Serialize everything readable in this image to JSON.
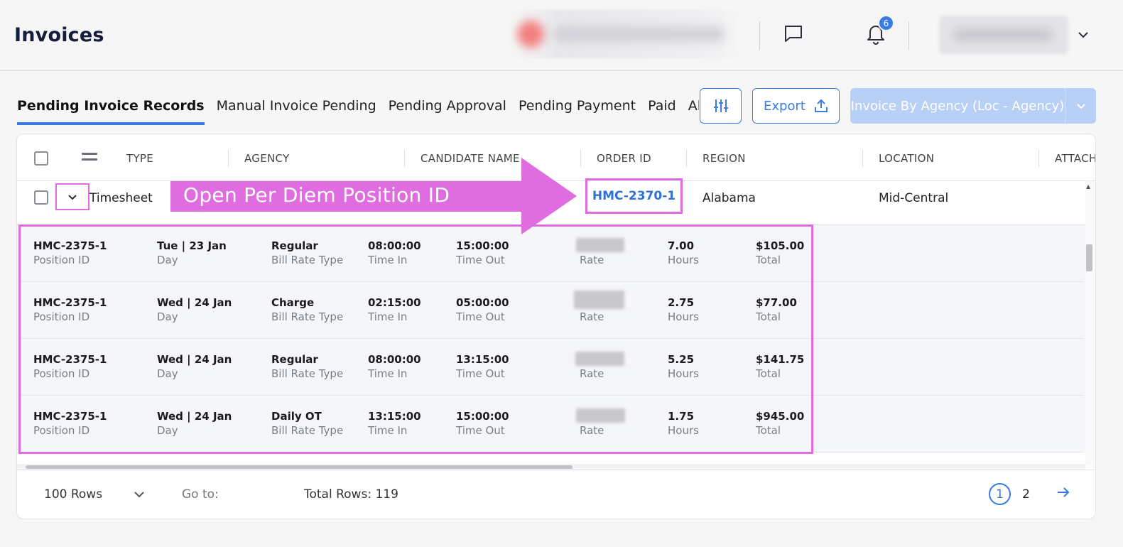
{
  "header": {
    "title": "Invoices",
    "notification_count": "6"
  },
  "tabs": [
    {
      "label": "Pending Invoice Records",
      "active": true
    },
    {
      "label": "Manual Invoice Pending",
      "active": false
    },
    {
      "label": "Pending Approval",
      "active": false
    },
    {
      "label": "Pending Payment",
      "active": false
    },
    {
      "label": "Paid",
      "active": false
    },
    {
      "label": "All Inv",
      "active": false
    }
  ],
  "toolbar": {
    "export_label": "Export",
    "invoice_button_label": "Invoice By Agency (Loc - Agency)"
  },
  "grid": {
    "columns": [
      "TYPE",
      "AGENCY",
      "CANDIDATE NAME",
      "ORDER ID",
      "REGION",
      "LOCATION",
      "ATTACHI"
    ],
    "row": {
      "type": "Timesheet",
      "order_id": "HMC-2370-1",
      "region": "Alabama",
      "location": "Mid-Central"
    },
    "detail_labels": {
      "position_id": "Position ID",
      "day": "Day",
      "bill_rate_type": "Bill Rate Type",
      "time_in": "Time In",
      "time_out": "Time Out",
      "rate": "Rate",
      "hours": "Hours",
      "total": "Total"
    },
    "detail_rows": [
      {
        "position_id": "HMC-2375-1",
        "day": "Tue | 23 Jan",
        "bill_rate_type": "Regular",
        "time_in": "08:00:00",
        "time_out": "15:00:00",
        "hours": "7.00",
        "total": "$105.00"
      },
      {
        "position_id": "HMC-2375-1",
        "day": "Wed | 24 Jan",
        "bill_rate_type": "Charge",
        "time_in": "02:15:00",
        "time_out": "05:00:00",
        "hours": "2.75",
        "total": "$77.00"
      },
      {
        "position_id": "HMC-2375-1",
        "day": "Wed | 24 Jan",
        "bill_rate_type": "Regular",
        "time_in": "08:00:00",
        "time_out": "13:15:00",
        "hours": "5.25",
        "total": "$141.75"
      },
      {
        "position_id": "HMC-2375-1",
        "day": "Wed | 24 Jan",
        "bill_rate_type": "Daily OT",
        "time_in": "13:15:00",
        "time_out": "15:00:00",
        "hours": "1.75",
        "total": "$945.00"
      }
    ]
  },
  "footer": {
    "rows_label": "100 Rows",
    "goto_label": "Go to:",
    "total_rows": "Total Rows: 119",
    "pages": [
      "1",
      "2"
    ]
  },
  "callout": {
    "text": "Open Per Diem Position ID",
    "color": "#df6ddf"
  },
  "colors": {
    "accent": "#3a7ce4",
    "link": "#2f6fd8",
    "highlight": "#df6ddf",
    "invoice_button": "#b8d0f6"
  }
}
